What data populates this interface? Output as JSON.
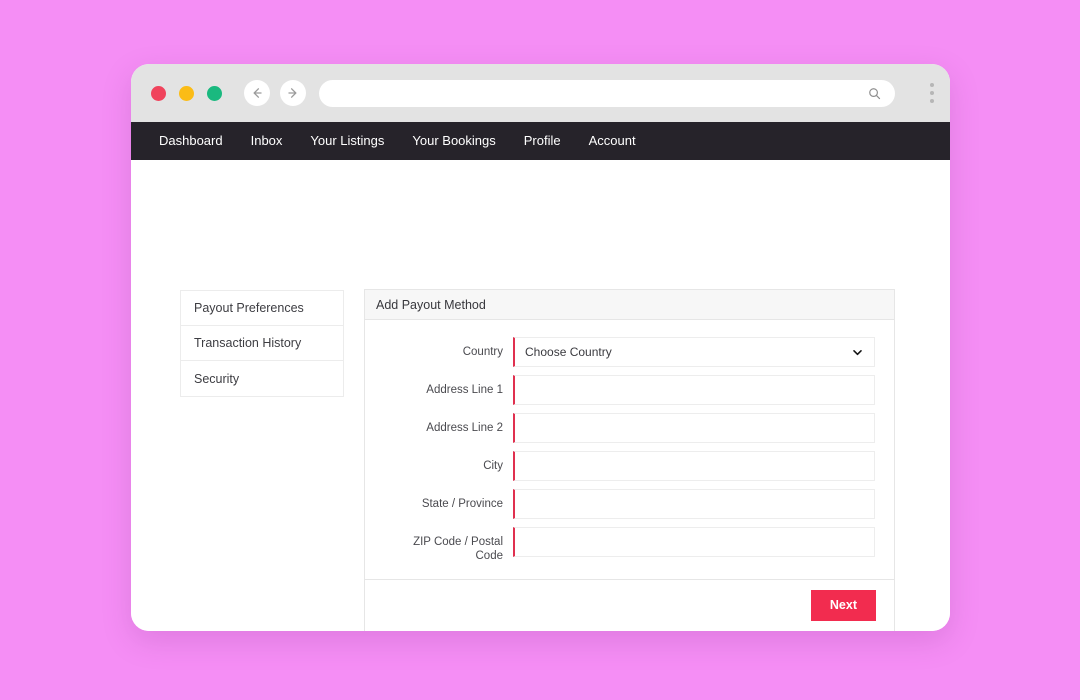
{
  "browser": {
    "traffic_lights": [
      {
        "name": "close",
        "color": "#f0435c"
      },
      {
        "name": "minimize",
        "color": "#fbbc16"
      },
      {
        "name": "maximize",
        "color": "#1ab97f"
      }
    ],
    "back_icon": "arrow-left-icon",
    "forward_icon": "arrow-right-icon",
    "url_value": "",
    "url_placeholder": "",
    "search_icon": "search-icon",
    "menu_icon": "kebab-menu-icon"
  },
  "navbar": {
    "background": "#26232a",
    "items": [
      {
        "label": "Dashboard"
      },
      {
        "label": "Inbox"
      },
      {
        "label": "Your Listings"
      },
      {
        "label": "Your Bookings"
      },
      {
        "label": "Profile"
      },
      {
        "label": "Account"
      }
    ]
  },
  "sidebar": {
    "items": [
      {
        "label": "Payout Preferences"
      },
      {
        "label": "Transaction History"
      },
      {
        "label": "Security"
      }
    ]
  },
  "card": {
    "title": "Add Payout Method",
    "accent_color": "#e0304f",
    "fields": [
      {
        "label": "Country",
        "type": "select",
        "value": "Choose Country",
        "placeholder": "Choose Country",
        "icon": "chevron-down-icon"
      },
      {
        "label": "Address Line 1",
        "type": "text",
        "value": "",
        "placeholder": ""
      },
      {
        "label": "Address Line 2",
        "type": "text",
        "value": "",
        "placeholder": ""
      },
      {
        "label": "City",
        "type": "text",
        "value": "",
        "placeholder": ""
      },
      {
        "label": "State / Province",
        "type": "text",
        "value": "",
        "placeholder": ""
      },
      {
        "label": "ZIP Code / Postal Code",
        "type": "text",
        "value": "",
        "placeholder": ""
      }
    ],
    "footer": {
      "next_label": "Next",
      "next_color": "#f22c4f"
    }
  },
  "page": {
    "background": "#f58ef5"
  }
}
